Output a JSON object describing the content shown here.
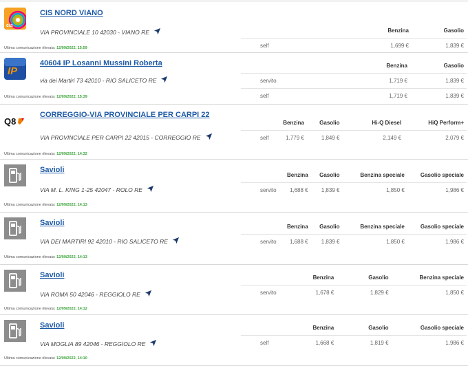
{
  "stations": [
    {
      "name": "CIS NORD VIANO",
      "address": "VIA PROVINCIALE 10 42030 - VIANO RE",
      "last_label": "Ultima comunicazione rilevata:",
      "last_time": "12/09/2022, 15:59",
      "logo": "cis-logo",
      "headers": [
        "Benzina",
        "Gasolio"
      ],
      "rows": [
        {
          "mode": "self",
          "prices": [
            "1,699 €",
            "1,839 €"
          ]
        }
      ]
    },
    {
      "name": "40604 IP Losanni Mussini Roberta",
      "address": "via dei Martiri 73 42010 - RIO SALICETO RE",
      "last_label": "Ultima comunicazione rilevata:",
      "last_time": "12/09/2022, 15:39",
      "logo": "ip-logo",
      "headers": [
        "Benzina",
        "Gasolio"
      ],
      "rows": [
        {
          "mode": "servito",
          "prices": [
            "1,719 €",
            "1,839 €"
          ]
        },
        {
          "mode": "self",
          "prices": [
            "1,719 €",
            "1,839 €"
          ]
        }
      ]
    },
    {
      "name": "CORREGGIO-VIA PROVINCIALE PER CARPI 22",
      "address": "VIA PROVINCIALE PER CARPI 22 42015 - CORREGGIO RE",
      "last_label": "Ultima comunicazione rilevata:",
      "last_time": "12/09/2022, 14:32",
      "logo": "q8-logo",
      "logo_text": "Q8",
      "headers": [
        "Benzina",
        "Gasolio",
        "Hi-Q Diesel",
        "HiQ Perform+"
      ],
      "rows": [
        {
          "mode": "self",
          "prices": [
            "1,779 €",
            "1,849 €",
            "2,149 €",
            "2,079 €"
          ]
        }
      ]
    },
    {
      "name": "Savioli",
      "address": "VIA M. L. KING 1-25 42047 - ROLO RE",
      "last_label": "Ultima comunicazione rilevata:",
      "last_time": "12/09/2022, 14:13",
      "logo": "fuel-pump-logo",
      "headers": [
        "Benzina",
        "Gasolio",
        "Benzina speciale",
        "Gasolio speciale"
      ],
      "rows": [
        {
          "mode": "servito",
          "prices": [
            "1,688 €",
            "1,839 €",
            "1,850 €",
            "1,986 €"
          ]
        }
      ]
    },
    {
      "name": "Savioli",
      "address": "VIA DEI MARTIRI 92 42010 - RIO SALICETO RE",
      "last_label": "Ultima comunicazione rilevata:",
      "last_time": "12/09/2022, 14:13",
      "logo": "fuel-pump-logo",
      "headers": [
        "Benzina",
        "Gasolio",
        "Benzina speciale",
        "Gasolio speciale"
      ],
      "rows": [
        {
          "mode": "servito",
          "prices": [
            "1,688 €",
            "1,839 €",
            "1,850 €",
            "1,986 €"
          ]
        }
      ]
    },
    {
      "name": "Savioli",
      "address": "VIA ROMA 50 42046 - REGGIOLO RE",
      "last_label": "Ultima comunicazione rilevata:",
      "last_time": "12/09/2022, 14:12",
      "logo": "fuel-pump-logo",
      "headers": [
        "Benzina",
        "Gasolio",
        "Benzina speciale"
      ],
      "rows": [
        {
          "mode": "servito",
          "prices": [
            "1,678 €",
            "1,829 €",
            "1,850 €"
          ]
        }
      ]
    },
    {
      "name": "Savioli",
      "address": "VIA MOGLIA 89 42046 - REGGIOLO RE",
      "last_label": "Ultima comunicazione rilevata:",
      "last_time": "12/09/2022, 14:10",
      "logo": "fuel-pump-logo",
      "headers": [
        "Benzina",
        "Gasolio",
        "Gasolio speciale"
      ],
      "rows": [
        {
          "mode": "self",
          "prices": [
            "1,668 €",
            "1,819 €",
            "1,986 €"
          ]
        }
      ]
    }
  ],
  "colors": {
    "link": "#1d5aa5",
    "timestamp": "#3aa43a",
    "divider": "#d9d9d9"
  }
}
